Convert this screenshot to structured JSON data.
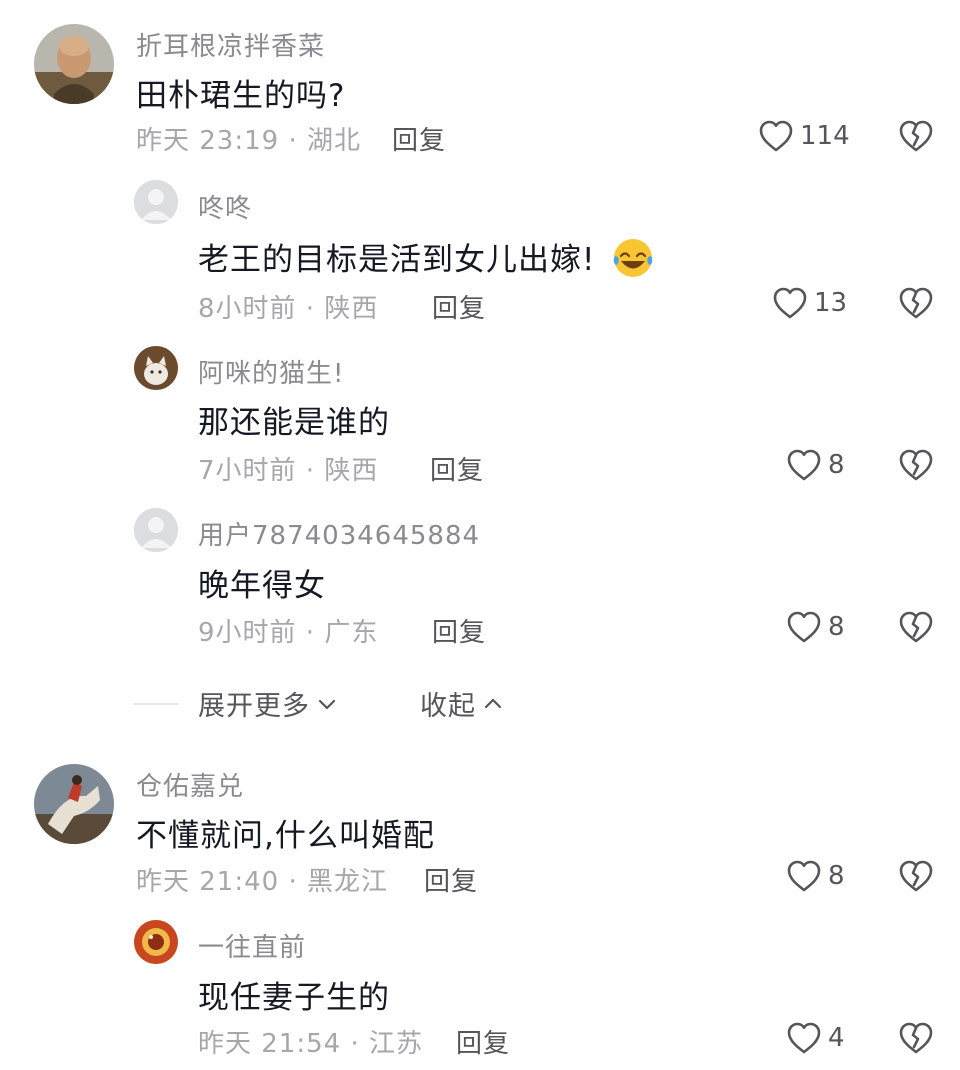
{
  "comments": [
    {
      "user": "折耳根凉拌香菜",
      "text": "田朴珺生的吗?",
      "time": "昨天 23:19",
      "location": "湖北",
      "reply_label": "回复",
      "likes": "114",
      "avatar": "monk-avatar"
    },
    {
      "user": "咚咚",
      "text": "老王的目标是活到女儿出嫁!",
      "emoji": "laughing-tears-emoji",
      "time": "8小时前",
      "location": "陕西",
      "reply_label": "回复",
      "likes": "13",
      "avatar": "default-avatar"
    },
    {
      "user": "阿咪的猫生!",
      "text": "那还能是谁的",
      "time": "7小时前",
      "location": "陕西",
      "reply_label": "回复",
      "likes": "8",
      "avatar": "cat-avatar"
    },
    {
      "user": "用户7874034645884",
      "text": "晚年得女",
      "time": "9小时前",
      "location": "广东",
      "reply_label": "回复",
      "likes": "8",
      "avatar": "default-avatar"
    },
    {
      "user": "仓佑嘉兑",
      "text": "不懂就问,什么叫婚配",
      "time": "昨天 21:40",
      "location": "黑龙江",
      "reply_label": "回复",
      "likes": "8",
      "avatar": "horse-painting-avatar"
    },
    {
      "user": "一往直前",
      "text": "现任妻子生的",
      "time": "昨天 21:54",
      "location": "江苏",
      "reply_label": "回复",
      "likes": "4",
      "avatar": "food-avatar"
    }
  ],
  "thread_controls": {
    "expand_label": "展开更多",
    "collapse_label": "收起"
  },
  "separator": " · ",
  "colors": {
    "text": "#161823",
    "secondary": "#8a8b91",
    "meta": "#a6a7ab",
    "action": "#55565c"
  }
}
